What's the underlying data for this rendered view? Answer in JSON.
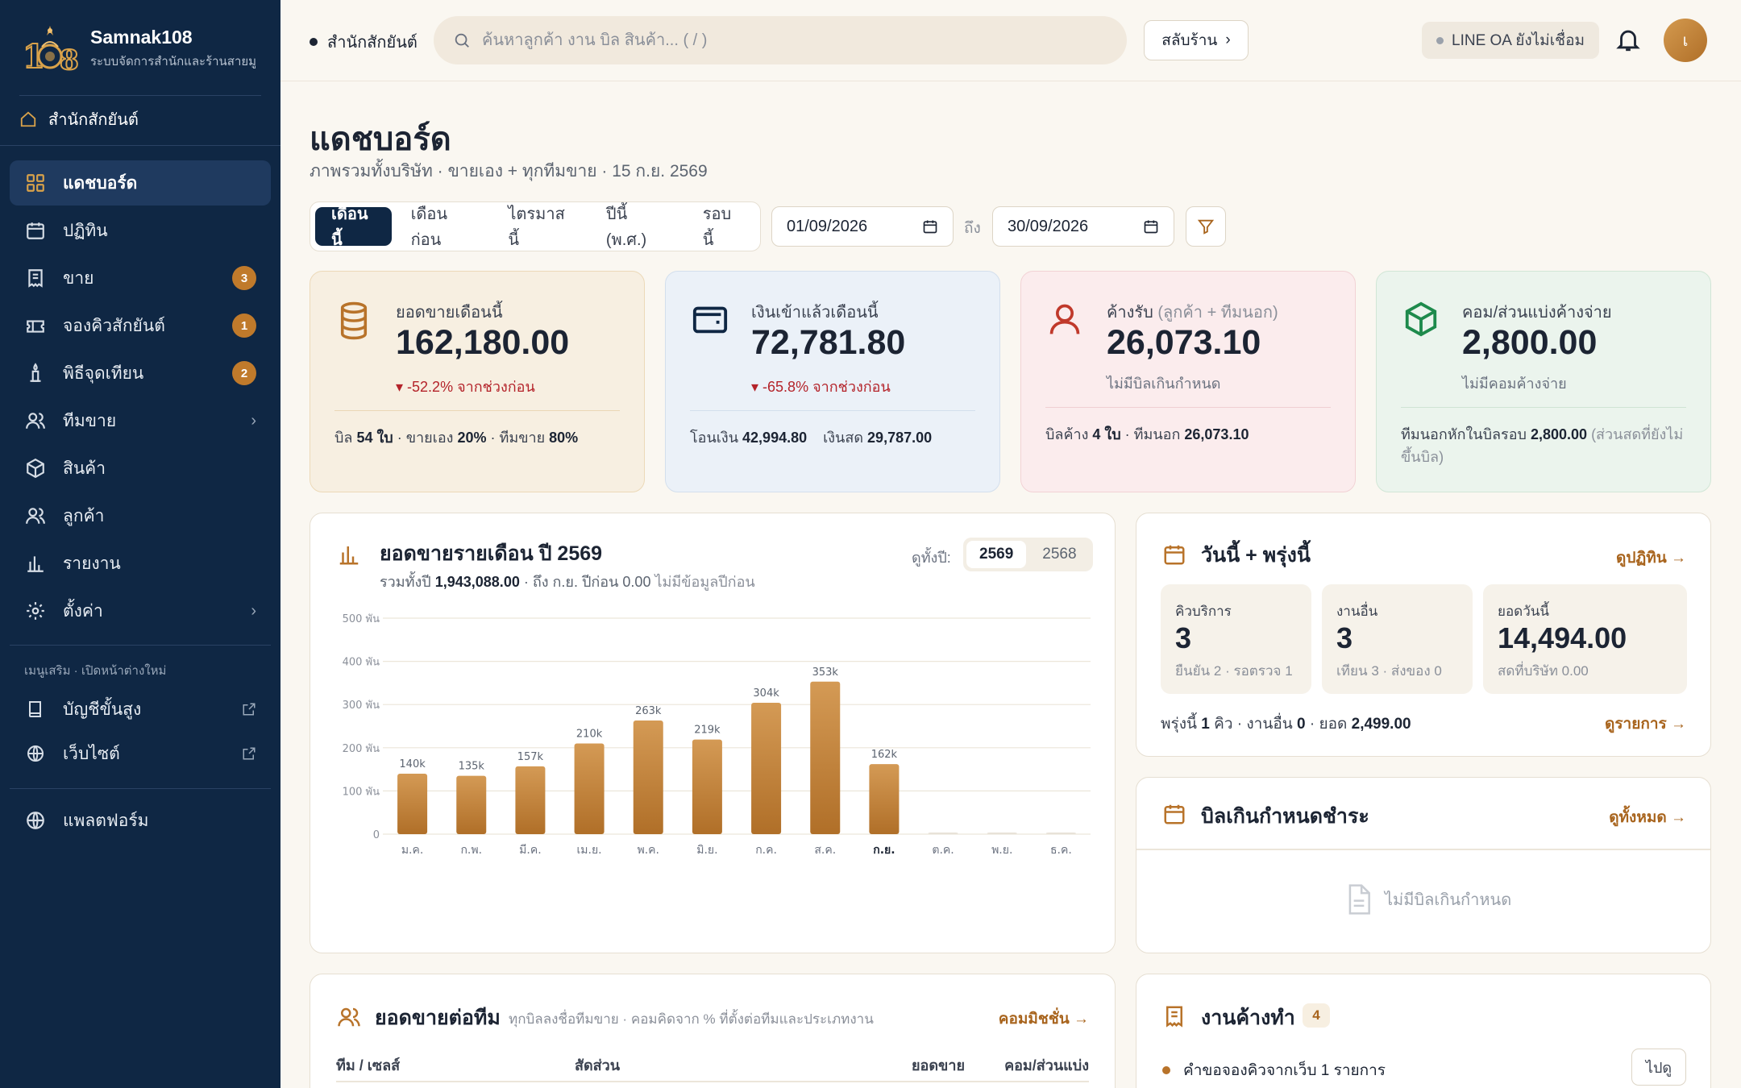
{
  "sidebar": {
    "brand_name": "Samnak108",
    "brand_sub": "ระบบจัดการสำนักและร้านสายมู",
    "office": "สำนักสักยันต์",
    "items": [
      {
        "label": "แดชบอร์ด",
        "icon": "grid-icon"
      },
      {
        "label": "ปฏิทิน",
        "icon": "calendar-icon"
      },
      {
        "label": "ขาย",
        "icon": "receipt-icon",
        "badge": "3"
      },
      {
        "label": "จองคิวสักยันต์",
        "icon": "ticket-icon",
        "badge": "1"
      },
      {
        "label": "พิธีจุดเทียน",
        "icon": "candle-icon",
        "badge": "2"
      },
      {
        "label": "ทีมขาย",
        "icon": "users-icon"
      },
      {
        "label": "สินค้า",
        "icon": "box-icon"
      },
      {
        "label": "ลูกค้า",
        "icon": "users-icon"
      },
      {
        "label": "รายงาน",
        "icon": "bar-chart-icon"
      },
      {
        "label": "ตั้งค่า",
        "icon": "gear-icon"
      }
    ],
    "extra_heading": "เมนูเสริม · เปิดหน้าต่างใหม่",
    "extra_items": [
      {
        "label": "บัญชีขั้นสูง",
        "icon": "book-icon"
      },
      {
        "label": "เว็บไซต์",
        "icon": "globe-icon"
      }
    ],
    "platform": "แพลตฟอร์ม"
  },
  "topbar": {
    "crumb": "สำนักสักยันต์",
    "search_placeholder": "ค้นหาลูกค้า งาน บิล สินค้า... ( / )",
    "switch_label": "สลับร้าน",
    "line_oa": "LINE OA ยังไม่เชื่อม",
    "avatar_initial": "เ"
  },
  "page": {
    "title": "แดชบอร์ด",
    "subtitle": "ภาพรวมทั้งบริษัท · ขายเอง + ทุกทีมขาย · 15 ก.ย. 2569",
    "period_tabs": [
      "เดือนนี้",
      "เดือนก่อน",
      "ไตรมาสนี้",
      "ปีนี้ (พ.ศ.)",
      "รอบนี้"
    ],
    "date_from": "01/09/2026",
    "date_to_label": "ถึง",
    "date_to": "30/09/2026"
  },
  "stats": [
    {
      "label": "ยอดขายเดือนนี้",
      "value": "162,180.00",
      "change": "▾ -52.2% จากช่วงก่อน",
      "foot": [
        "บิล ",
        "54 ใบ",
        " · ขายเอง ",
        "20%",
        " · ทีมขาย ",
        "80%"
      ]
    },
    {
      "label": "เงินเข้าแล้วเดือนนี้",
      "value": "72,781.80",
      "change": "▾ -65.8% จากช่วงก่อน",
      "foot": [
        "โอนเงิน ",
        "42,994.80",
        "    เงินสด ",
        "29,787.00"
      ]
    },
    {
      "label": "ค้างรับ",
      "label_muted": "(ลูกค้า + ทีมนอก)",
      "value": "26,073.10",
      "note": "ไม่มีบิลเกินกำหนด",
      "foot": [
        "บิลค้าง ",
        "4 ใบ",
        " · ทีมนอก ",
        "26,073.10"
      ]
    },
    {
      "label": "คอม/ส่วนแบ่งค้างจ่าย",
      "value": "2,800.00",
      "note": "ไม่มีคอมค้างจ่าย",
      "foot": [
        "ทีมนอกหักในบิลรอบ ",
        "2,800.00",
        " ",
        "(ส่วนสดที่ยังไม่ขึ้นบิล)"
      ]
    }
  ],
  "colors": {
    "accent": "#a8641d",
    "navy": "#0f2744",
    "bar_top": "#d49a55",
    "bar_bottom": "#b06f28",
    "negative": "#b4232a"
  },
  "monthly": {
    "title": "ยอดขายรายเดือน ปี 2569",
    "subtitle": [
      "รวมทั้งปี ",
      "1,943,088.00",
      " · ถึง ก.ย. ปีก่อน 0.00 ",
      "ไม่มีข้อมูลปีก่อน"
    ],
    "view_year_label": "ดูทั้งปี:",
    "years": [
      "2569",
      "2568"
    ]
  },
  "chart_data": {
    "type": "bar",
    "categories": [
      "ม.ค.",
      "ก.พ.",
      "มี.ค.",
      "เม.ย.",
      "พ.ค.",
      "มิ.ย.",
      "ก.ค.",
      "ส.ค.",
      "ก.ย.",
      "ต.ค.",
      "พ.ย.",
      "ธ.ค."
    ],
    "values": [
      140,
      135,
      157,
      210,
      263,
      219,
      304,
      353,
      162,
      0,
      0,
      0
    ],
    "value_labels": [
      "140k",
      "135k",
      "157k",
      "210k",
      "263k",
      "219k",
      "304k",
      "353k",
      "162k",
      "",
      "",
      ""
    ],
    "yticks": [
      0,
      100,
      200,
      300,
      400,
      500
    ],
    "ytick_labels": [
      "0",
      "100 พัน",
      "200 พัน",
      "300 พัน",
      "400 พัน",
      "500 พัน"
    ],
    "ylim": [
      0,
      500
    ],
    "highlight_index": 8,
    "grid": true
  },
  "today": {
    "title": "วันนี้ + พรุ่งนี้",
    "link": "ดูปฏิทิน",
    "minis": [
      {
        "label": "คิวบริการ",
        "value": "3",
        "sub": "ยืนยัน 2 · รอตรวจ 1"
      },
      {
        "label": "งานอื่น",
        "value": "3",
        "sub": "เทียน 3 · ส่งของ 0"
      },
      {
        "label": "ยอดวันนี้",
        "value": "14,494.00",
        "sub": "สดที่บริษัท 0.00"
      }
    ],
    "tomorrow": [
      "พรุ่งนี้ ",
      "1",
      " คิว · งานอื่น ",
      "0",
      " · ยอด ",
      "2,499.00"
    ],
    "tomorrow_link": "ดูรายการ"
  },
  "overdue": {
    "title": "บิลเกินกำหนดชำระ",
    "link": "ดูทั้งหมด",
    "empty": "ไม่มีบิลเกินกำหนด"
  },
  "team": {
    "title": "ยอดขายต่อทีม",
    "subtitle": "ทุกบิลลงชื่อทีมขาย · คอมคิดจาก % ที่ตั้งต่อทีมและประเภทงาน",
    "link": "คอมมิชชั่น",
    "columns": [
      "ทีม / เซลส์",
      "สัดส่วน",
      "ยอดขาย",
      "คอม/ส่วนแบ่ง"
    ]
  },
  "pending": {
    "title": "งานค้างทำ",
    "count": "4",
    "items": [
      {
        "text": "คำขอจองคิวจากเว็บ 1 รายการ",
        "action": "ไปดู"
      }
    ]
  }
}
